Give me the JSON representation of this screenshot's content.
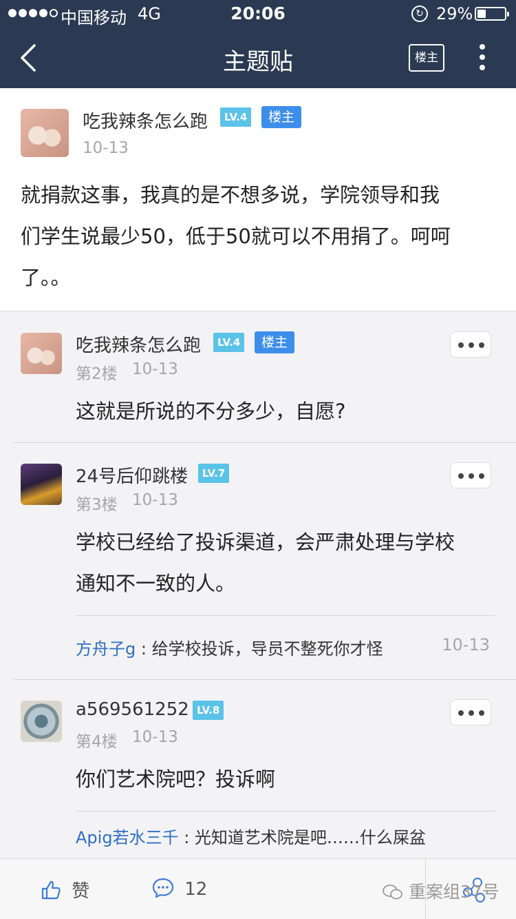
{
  "status_bar": {
    "carrier": "中国移动",
    "network": "4G",
    "time": "20:06",
    "battery": "29%"
  },
  "nav": {
    "title": "主题贴",
    "owner_button": "楼主"
  },
  "main_post": {
    "author": "吃我辣条怎么跑",
    "level": "LV.4",
    "owner_tag": "楼主",
    "date": "10-13",
    "lines": [
      "就捐款这事，我真的是不想多说，学院领导和我",
      "们学生说最少50，低于50就可以不用捐了。呵呵",
      "了。。"
    ]
  },
  "replies": [
    {
      "author": "吃我辣条怎么跑",
      "level": "LV.4",
      "owner_tag": "楼主",
      "floor": "第2楼",
      "date": "10-13",
      "lines": [
        "这就是所说的不分多少，自愿?"
      ]
    },
    {
      "author": "24号后仰跳楼",
      "level": "LV.7",
      "floor": "第3楼",
      "date": "10-13",
      "lines": [
        "学校已经给了投诉渠道，会严肃处理与学校",
        "通知不一致的人。"
      ],
      "sub": {
        "author": "方舟子g",
        "sep": " : ",
        "text": "给学校投诉，导员不整死你才怪",
        "date": "10-13"
      }
    },
    {
      "author": "a569561252",
      "level": "LV.8",
      "floor": "第4楼",
      "date": "10-13",
      "lines": [
        "你们艺术院吧？投诉啊"
      ],
      "sub": {
        "author": "Apig若水三千",
        "sep": " : ",
        "text": "光知道艺术院是吧……什么屎盆"
      }
    }
  ],
  "bottom_bar": {
    "like": "赞",
    "comments": "12",
    "watermark": "重案组37号"
  }
}
